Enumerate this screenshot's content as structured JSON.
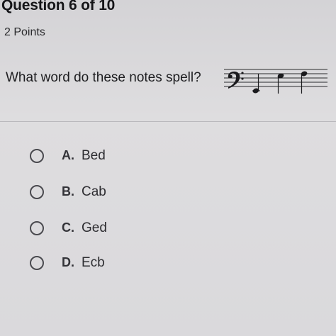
{
  "header": {
    "title": "Question 6 of 10",
    "points": "2 Points"
  },
  "question": {
    "text": "What word do these notes spell?",
    "staff_icon": "bass-clef-staff-icon"
  },
  "options": [
    {
      "letter": "A.",
      "text": "Bed",
      "selected": false
    },
    {
      "letter": "B.",
      "text": "Cab",
      "selected": false
    },
    {
      "letter": "C.",
      "text": "Ged",
      "selected": false
    },
    {
      "letter": "D.",
      "text": "Ecb",
      "selected": false
    }
  ],
  "colors": {
    "background": "#dcdbdd",
    "text": "#1d1d1f",
    "radio_border": "#4a4a4f",
    "divider": "#b9b8bc"
  }
}
